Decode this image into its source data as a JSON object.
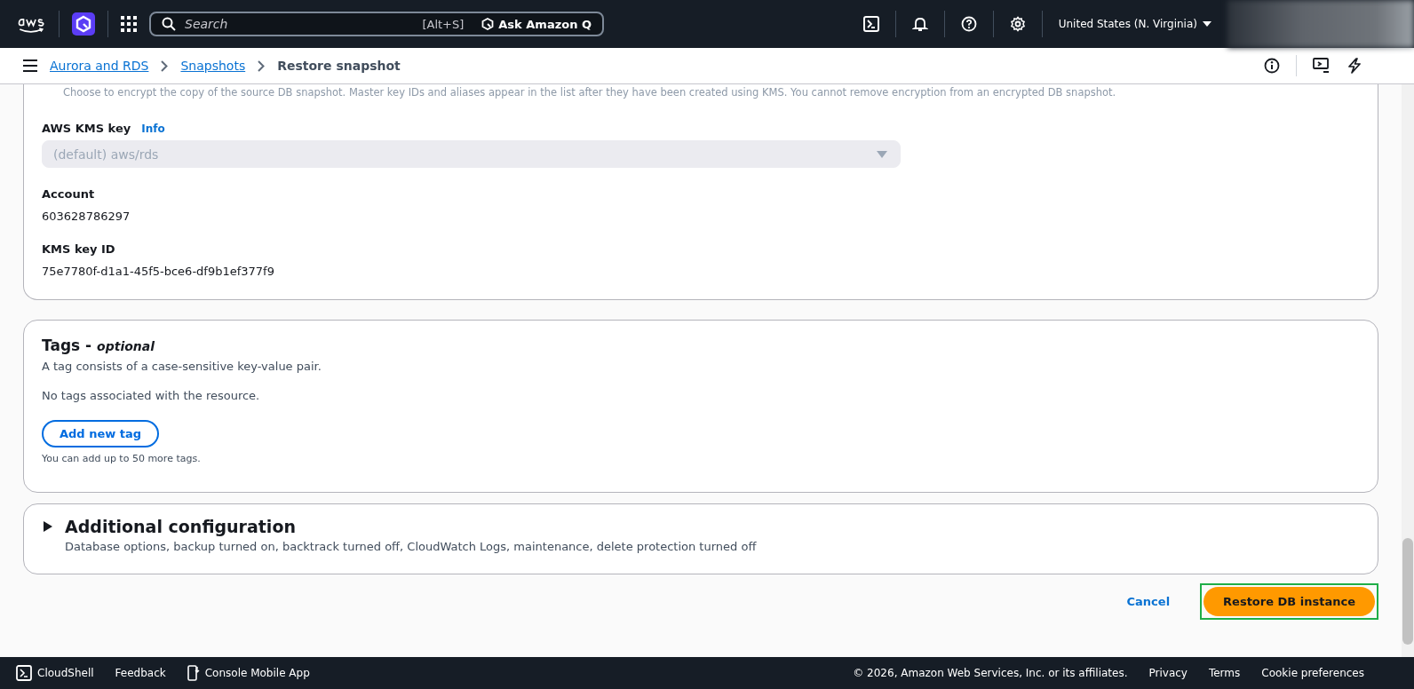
{
  "top_nav": {
    "search": {
      "placeholder": "Search",
      "shortcut": "[Alt+S]"
    },
    "ask_button": "Ask Amazon Q",
    "region": "United States (N. Virginia)"
  },
  "breadcrumbs": [
    {
      "label": "Aurora and RDS",
      "kind": "link"
    },
    {
      "label": "Snapshots",
      "kind": "link"
    },
    {
      "label": "Restore snapshot",
      "kind": "current"
    }
  ],
  "encryption": {
    "hint": "Choose to encrypt the copy of the source DB snapshot. Master key IDs and aliases appear in the list after they have been created using KMS. You cannot remove encryption from an encrypted DB snapshot.",
    "kms_key_label": "AWS KMS key",
    "info_link": "Info",
    "kms_key_value": "(default) aws/rds",
    "disabled": true,
    "fields": [
      {
        "label": "Account",
        "value": "603628786297"
      },
      {
        "label": "KMS key ID",
        "value": "75e7780f-d1a1-45f5-bce6-df9b1ef377f9"
      }
    ]
  },
  "tags": {
    "title": "Tags - ",
    "title_suffix": "optional",
    "description": "A tag consists of a case-sensitive key-value pair.",
    "empty_text": "No tags associated with the resource.",
    "add_button": "Add new tag",
    "limit_text": "You can add up to 50 more tags."
  },
  "additional_configuration": {
    "title": "Additional configuration",
    "expanded": false,
    "description": "Database options, backup turned on, backtrack turned off, CloudWatch Logs, maintenance, delete protection turned off"
  },
  "actions": {
    "cancel": "Cancel",
    "primary": "Restore DB instance",
    "highlighted": true
  },
  "footer": {
    "left": [
      "CloudShell",
      "Feedback",
      "Console Mobile App"
    ],
    "copyright": "© 2026, Amazon Web Services, Inc. or its affiliates.",
    "links": [
      "Privacy",
      "Terms",
      "Cookie preferences"
    ]
  }
}
